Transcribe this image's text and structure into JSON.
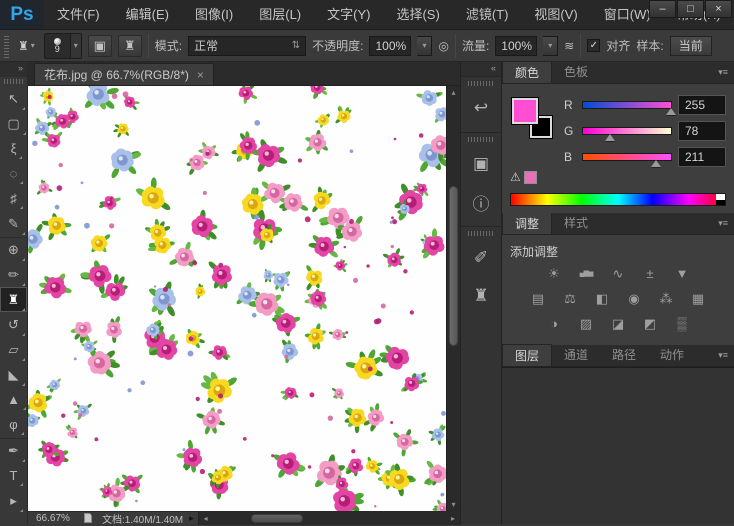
{
  "app": {
    "logo": "Ps",
    "window_controls": {
      "minimize": "–",
      "maximize": "□",
      "close": "×"
    }
  },
  "menubar": {
    "items": [
      "文件(F)",
      "编辑(E)",
      "图像(I)",
      "图层(L)",
      "文字(Y)",
      "选择(S)",
      "滤镜(T)",
      "视图(V)",
      "窗口(W)",
      "帮助(H)"
    ]
  },
  "options_bar": {
    "active_tool_glyph": "♜",
    "brush_size": "9",
    "toggle_buttons": [
      {
        "name": "brush-panel-toggle",
        "glyph": "▣"
      },
      {
        "name": "clone-source-panel-toggle",
        "glyph": "♜"
      }
    ],
    "mode_label": "模式:",
    "mode_value": "正常",
    "opacity_label": "不透明度:",
    "opacity_value": "100%",
    "pressure_icon_glyph": "◎",
    "flow_label": "流量:",
    "flow_value": "100%",
    "airbrush_icon_glyph": "≋",
    "align_checked_glyph": "✓",
    "align_label": "对齐",
    "sample_label": "样本:",
    "sample_value": "当前"
  },
  "toolbar": {
    "collapse_glyph": "»",
    "tools": [
      {
        "name": "move-tool",
        "glyph": "↖",
        "selected": false,
        "break": false
      },
      {
        "name": "rectangular-marquee-tool",
        "glyph": "▢",
        "selected": false,
        "break": false
      },
      {
        "name": "lasso-tool",
        "glyph": "ξ",
        "selected": false,
        "break": false
      },
      {
        "name": "quick-selection-tool",
        "glyph": "◌",
        "selected": false,
        "break": false
      },
      {
        "name": "crop-tool",
        "glyph": "♯",
        "selected": false,
        "break": false
      },
      {
        "name": "eyedropper-tool",
        "glyph": "✎",
        "selected": false,
        "break": false
      },
      {
        "name": "spot-healing-brush-tool",
        "glyph": "⊕",
        "selected": false,
        "break": true
      },
      {
        "name": "brush-tool",
        "glyph": "✏",
        "selected": false,
        "break": false
      },
      {
        "name": "clone-stamp-tool",
        "glyph": "♜",
        "selected": true,
        "break": false
      },
      {
        "name": "history-brush-tool",
        "glyph": "↺",
        "selected": false,
        "break": false
      },
      {
        "name": "eraser-tool",
        "glyph": "▱",
        "selected": false,
        "break": false
      },
      {
        "name": "gradient-tool",
        "glyph": "◣",
        "selected": false,
        "break": false
      },
      {
        "name": "blur-tool",
        "glyph": "▲",
        "selected": false,
        "break": false
      },
      {
        "name": "dodge-tool",
        "glyph": "φ",
        "selected": false,
        "break": false
      },
      {
        "name": "pen-tool",
        "glyph": "✒",
        "selected": false,
        "break": true
      },
      {
        "name": "type-tool",
        "glyph": "T",
        "selected": false,
        "break": false
      },
      {
        "name": "path-selection-tool",
        "glyph": "▸",
        "selected": false,
        "break": false
      }
    ]
  },
  "document": {
    "tab_title": "花布.jpg @ 66.7%(RGB/8*)",
    "close_glyph": "×"
  },
  "canvas": {
    "background": "#fefefe",
    "palettes": [
      {
        "petal": "#e245a4",
        "deep": "#b51e74",
        "light": "#f7b8dc"
      },
      {
        "petal": "#f29cc6",
        "deep": "#d4679f",
        "light": "#fcdce9"
      },
      {
        "petal": "#f8d922",
        "deep": "#dba70e",
        "light": "#fdf3a0"
      },
      {
        "petal": "#a9c0e9",
        "deep": "#7e97cf",
        "light": "#dbe6f7"
      }
    ],
    "leaf_colors": [
      "#4ea733",
      "#3e8f27",
      "#67b944"
    ]
  },
  "panel_strip": {
    "collapse_glyph": "«",
    "groups": [
      [
        {
          "name": "history-panel",
          "glyph": "↩"
        }
      ],
      [
        {
          "name": "properties-panel",
          "glyph": "▣"
        },
        {
          "name": "info-panel",
          "glyph": "ⓘ"
        }
      ],
      [
        {
          "name": "brush-panel",
          "glyph": "✐"
        },
        {
          "name": "clone-source-panel",
          "glyph": "♜"
        }
      ]
    ]
  },
  "panels": {
    "color": {
      "tabs": [
        "颜色",
        "色板"
      ],
      "active_tab": 0,
      "menu_glyph": "▾≡",
      "foreground_color": "#FF4ED3",
      "background_color": "#000000",
      "gamut_warning_glyph": "⚠",
      "gamut_swatch_color": "#E86EB8",
      "channels": [
        {
          "label": "R",
          "value": "255",
          "pos": 1.0,
          "grad_start": "#004ED3",
          "grad_end": "#FF4ED3"
        },
        {
          "label": "G",
          "value": "78",
          "pos": 0.306,
          "grad_start": "#FF00D3",
          "grad_end": "#FFFFD3"
        },
        {
          "label": "B",
          "value": "211",
          "pos": 0.827,
          "grad_start": "#FF4E00",
          "grad_end": "#FF4EFF"
        }
      ]
    },
    "adjustments": {
      "tabs": [
        "调整",
        "样式"
      ],
      "active_tab": 0,
      "menu_glyph": "▾≡",
      "heading": "添加调整",
      "rows": [
        [
          {
            "name": "brightness-contrast",
            "glyph": "☀"
          },
          {
            "name": "levels",
            "glyph": "▄▆▅"
          },
          {
            "name": "curves",
            "glyph": "∿"
          },
          {
            "name": "exposure",
            "glyph": "±"
          },
          {
            "name": "vibrance",
            "glyph": "▼"
          }
        ],
        [
          {
            "name": "hue-saturation",
            "glyph": "▤"
          },
          {
            "name": "color-balance",
            "glyph": "⚖"
          },
          {
            "name": "black-white",
            "glyph": "◧"
          },
          {
            "name": "photo-filter",
            "glyph": "◉"
          },
          {
            "name": "channel-mixer",
            "glyph": "⁂"
          },
          {
            "name": "color-lookup",
            "glyph": "▦"
          }
        ],
        [
          {
            "name": "invert",
            "glyph": "◑"
          },
          {
            "name": "posterize",
            "glyph": "▨"
          },
          {
            "name": "threshold",
            "glyph": "◪"
          },
          {
            "name": "gradient-map",
            "glyph": "◩"
          },
          {
            "name": "selective-color",
            "glyph": "▒"
          }
        ]
      ]
    },
    "layers": {
      "tabs": [
        "图层",
        "通道",
        "路径",
        "动作"
      ],
      "active_tab": 0,
      "menu_glyph": "▾≡"
    }
  },
  "statusbar": {
    "zoom_level": "66.67%",
    "doc_info": "文档:1.40M/1.40M",
    "flyout_glyph": "▸"
  }
}
